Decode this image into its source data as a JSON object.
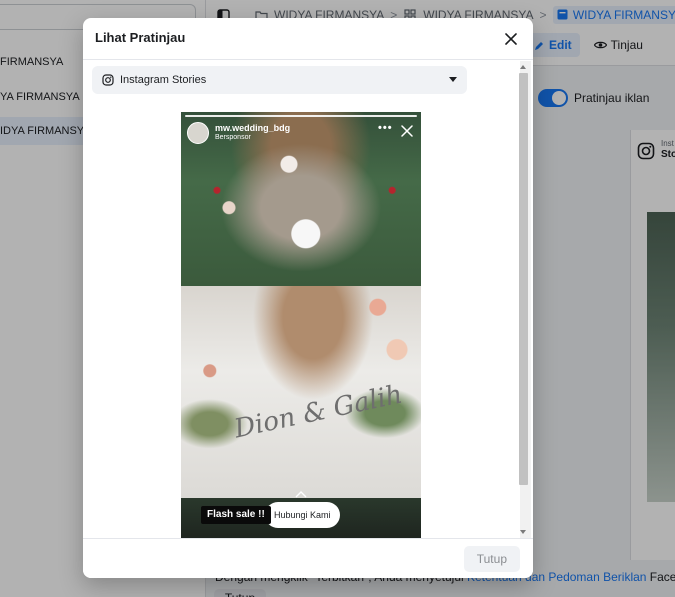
{
  "background": {
    "sidebar": {
      "items": [
        {
          "label": "FIRMANSYA",
          "selected": false
        },
        {
          "label": "YA FIRMANSYA",
          "selected": false
        },
        {
          "label": "IDYA FIRMANSYA",
          "selected": true
        }
      ]
    },
    "breadcrumb": {
      "items": [
        {
          "icon": "folder-icon",
          "label": "WIDYA FIRMANSYA"
        },
        {
          "icon": "grid-icon",
          "label": "WIDYA FIRMANSYA"
        },
        {
          "icon": "ad-square-icon",
          "label": "WIDYA FIRMANSYA"
        }
      ],
      "separator": ">"
    },
    "toolbar": {
      "edit_label": "Edit",
      "review_label": "Tinjau"
    },
    "ad_preview_toggle": {
      "label": "Pratinjau iklan",
      "on": true
    },
    "right_panel": {
      "label_line1": "Inst",
      "label_line2": "Sto"
    },
    "footer_text": {
      "part1": "Dengan mengklik \"Terbitkan\", Anda menyetujui ",
      "link": "Ketentuan dan Pedoman Beriklan",
      "part2": " Facebook."
    },
    "footer_button": "Tutup"
  },
  "modal": {
    "title": "Lihat Pratinjau",
    "placement_select": {
      "icon": "instagram-icon",
      "selected": "Instagram Stories"
    },
    "story": {
      "username": "mw.wedding_bdg",
      "sponsored_label": "Bersponsor",
      "script_text": "Dion & Galih",
      "flash_sticker": "Flash sale !!",
      "cta_label": "Hubungi Kami"
    },
    "footer": {
      "close_label": "Tutup"
    }
  },
  "colors": {
    "accent": "#1877f2",
    "overlay": "rgba(0,0,0,0.30)",
    "modal_bg": "#ffffff",
    "select_bg": "#f0f2f5"
  }
}
